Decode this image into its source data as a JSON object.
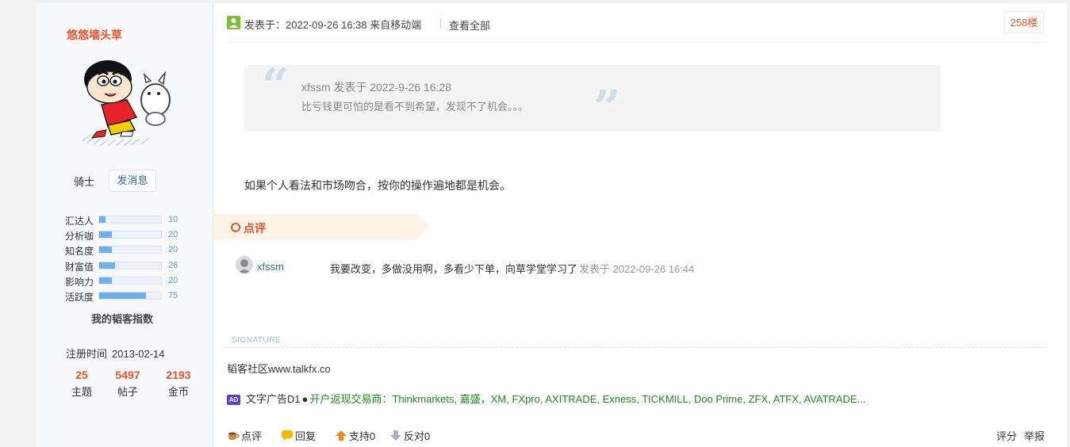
{
  "profile": {
    "username": "悠悠墙头草",
    "rank": "骑士",
    "message_button": "发消息",
    "stats": [
      {
        "label": "汇达人",
        "value": "10",
        "ratio": 0.1
      },
      {
        "label": "分析咖",
        "value": "20",
        "ratio": 0.2
      },
      {
        "label": "知名度",
        "value": "20",
        "ratio": 0.2
      },
      {
        "label": "财富值",
        "value": "26",
        "ratio": 0.26
      },
      {
        "label": "影响力",
        "value": "20",
        "ratio": 0.2
      },
      {
        "label": "活跃度",
        "value": "75",
        "ratio": 0.75
      }
    ],
    "index_title": "我的韬客指数",
    "reg_label": "注册时间",
    "reg_date": "2013-02-14",
    "counts": [
      {
        "value": "25",
        "label": "主题"
      },
      {
        "value": "5497",
        "label": "帖子"
      },
      {
        "value": "2193",
        "label": "金币"
      }
    ]
  },
  "post": {
    "meta": "发表于：2022-09-26 16:38  来自移动端",
    "view_all": "查看全部",
    "floor": "258楼",
    "quote_header": "xfssm 发表于 2022-9-26 16:28",
    "quote_body": "比亏钱更可怕的是看不到希望，发现不了机会。。。",
    "reply": "如果个人看法和市场吻合，按你的操作遍地都是机会。"
  },
  "comments": {
    "label": "点评",
    "items": [
      {
        "user": "xfssm",
        "text": "我要改变，多做没用啊，多看少下单，向草学堂学习了",
        "time": "发表于 2022-09-26 16:44"
      }
    ]
  },
  "signature": {
    "label": "SIGNATURE",
    "text": "韬客社区www.talkfx.co"
  },
  "ad": {
    "icon_text": "AD",
    "label": "文字广告D1",
    "bullet": "●",
    "text": "开户返现交易商：Thinkmarkets, 嘉盛，XM, FXpro, AXITRADE, Exness, TICKMILL, Doo Prime, ZFX, ATFX, AVATRADE..."
  },
  "actions": {
    "comment": "点评",
    "reply": "回复",
    "support": "支持0",
    "oppose": "反对0",
    "rate": "评分",
    "report": "举报"
  },
  "colors": {
    "accent": "#e8542a",
    "link": "#336699",
    "ad_green": "#1a8f1a",
    "bar_fill": "#6fb0ec"
  }
}
